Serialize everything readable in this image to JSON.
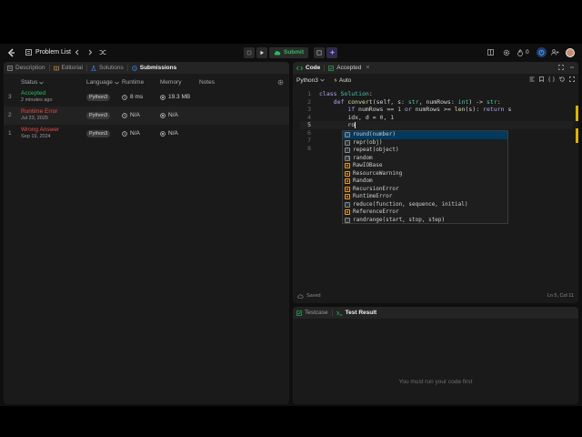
{
  "topbar": {
    "problem_list": "Problem List",
    "submit": "Submit",
    "streak": "0"
  },
  "left_tabs": [
    "Description",
    "Editorial",
    "Solutions",
    "Submissions"
  ],
  "table": {
    "headers": [
      "Status",
      "Language",
      "Runtime",
      "Memory",
      "Notes"
    ],
    "rows": [
      {
        "num": "3",
        "status": "Accepted",
        "status_color": "#2cbb5d",
        "date": "2 minutes ago",
        "lang": "Python3",
        "runtime": "8 ms",
        "memory": "19.3 MB"
      },
      {
        "num": "2",
        "status": "Runtime Error",
        "status_color": "#ef4743",
        "date": "Jul 23, 2025",
        "lang": "Python3",
        "runtime": "N/A",
        "memory": "N/A"
      },
      {
        "num": "1",
        "status": "Wrong Answer",
        "status_color": "#ef4743",
        "date": "Sep 19, 2024",
        "lang": "Python3",
        "runtime": "N/A",
        "memory": "N/A"
      }
    ]
  },
  "code_tabs": {
    "code": "Code",
    "accepted": "Accepted"
  },
  "editor": {
    "language": "Python3",
    "auto": "Auto",
    "saved": "Saved",
    "cursor": "Ln 5, Col 11",
    "line_numbers": [
      "1",
      "2",
      "3",
      "4",
      "5",
      "6",
      "7",
      "8"
    ]
  },
  "autocomplete": [
    {
      "label": "round(number)",
      "kind": "fn"
    },
    {
      "label": "repr(obj)",
      "kind": "fn"
    },
    {
      "label": "repeat(object)",
      "kind": "fn"
    },
    {
      "label": "random",
      "kind": "mod"
    },
    {
      "label": "RawIOBase",
      "kind": "cls"
    },
    {
      "label": "ResourceWarning",
      "kind": "cls"
    },
    {
      "label": "Random",
      "kind": "cls"
    },
    {
      "label": "RecursionError",
      "kind": "cls"
    },
    {
      "label": "RuntimeError",
      "kind": "cls"
    },
    {
      "label": "reduce(function, sequence, initial)",
      "kind": "fn"
    },
    {
      "label": "ReferenceError",
      "kind": "cls"
    },
    {
      "label": "randrange(start, stop, step)",
      "kind": "fn"
    }
  ],
  "bottom": {
    "testcase": "Testcase",
    "test_result": "Test Result",
    "empty": "You must run your code first"
  }
}
